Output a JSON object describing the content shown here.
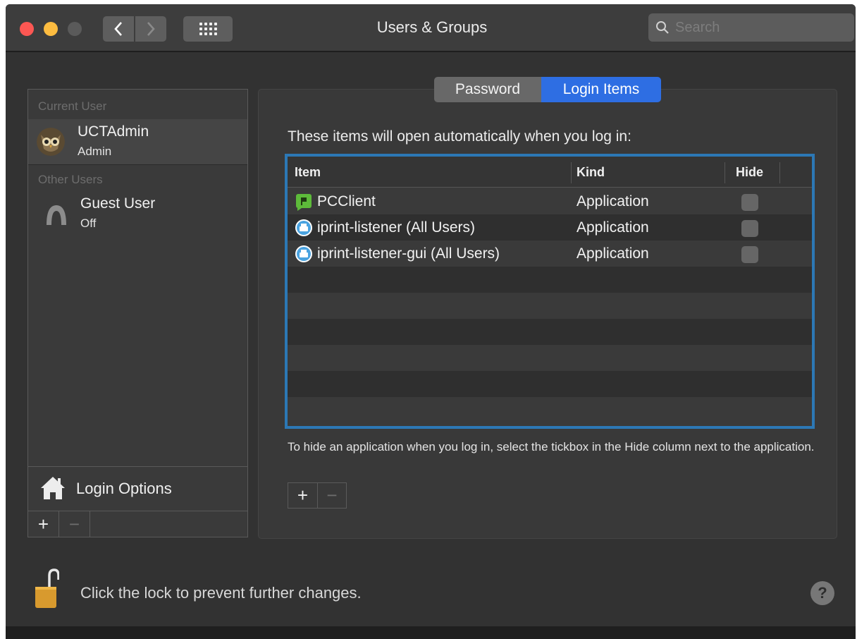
{
  "window": {
    "title": "Users & Groups",
    "search_placeholder": "Search"
  },
  "sidebar": {
    "current_user_header": "Current User",
    "current_user": {
      "name": "UCTAdmin",
      "role": "Admin"
    },
    "other_users_header": "Other Users",
    "other_users": [
      {
        "name": "Guest User",
        "status": "Off"
      }
    ],
    "login_options_label": "Login Options",
    "add_label": "+",
    "remove_label": "−"
  },
  "tabs": [
    {
      "label": "Password",
      "selected": false
    },
    {
      "label": "Login Items",
      "selected": true
    }
  ],
  "login_items": {
    "intro": "These items will open automatically when you log in:",
    "columns": {
      "item": "Item",
      "kind": "Kind",
      "hide": "Hide"
    },
    "rows": [
      {
        "item": "PCClient",
        "kind": "Application",
        "hide": false,
        "icon": "pcclient-icon"
      },
      {
        "item": "iprint-listener (All Users)",
        "kind": "Application",
        "hide": false,
        "icon": "iprint-icon"
      },
      {
        "item": "iprint-listener-gui (All Users)",
        "kind": "Application",
        "hide": false,
        "icon": "iprint-icon"
      }
    ],
    "hint": "To hide an application when you log in, select the tickbox in the Hide column next to the application.",
    "add_label": "+",
    "remove_label": "−"
  },
  "footer": {
    "lock_text": "Click the lock to prevent further changes.",
    "help_label": "?"
  },
  "colors": {
    "accent": "#2e6ee3",
    "table_focus": "#2c78b5",
    "close": "#fc5753",
    "minimize": "#fdbc40"
  }
}
